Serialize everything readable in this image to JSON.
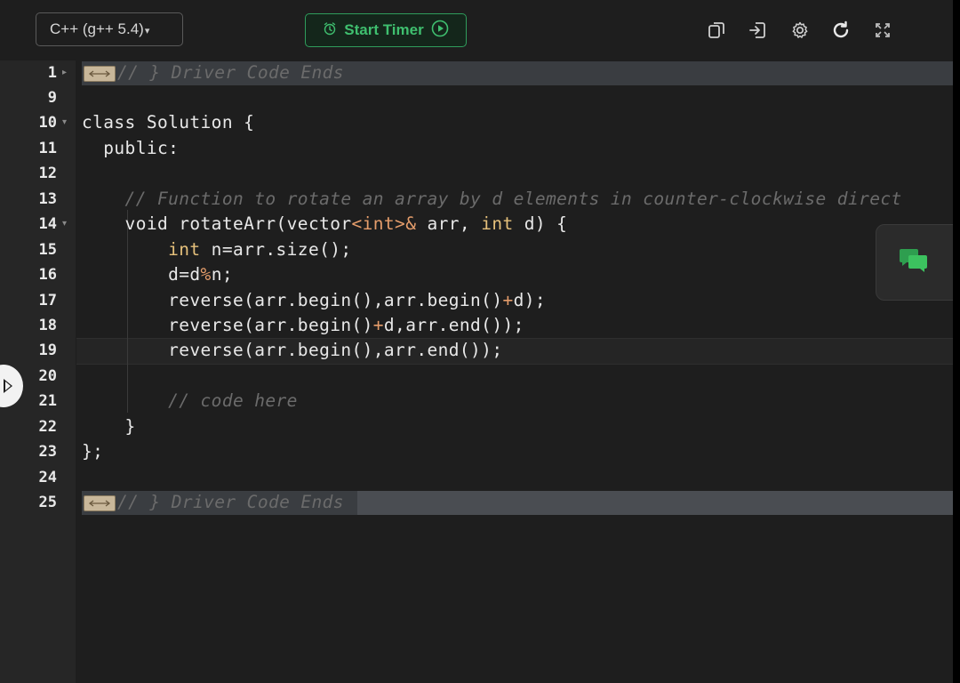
{
  "toolbar": {
    "language": "C++ (g++ 5.4)",
    "start_timer_label": "Start Timer",
    "icons": [
      "copy-icon",
      "sign-in-icon",
      "gear-icon",
      "refresh-icon",
      "fullscreen-icon"
    ]
  },
  "colors": {
    "accent_green": "#2f9d5c",
    "editor_bg": "#1e1e1e",
    "gutter_bg": "#262626"
  },
  "editor": {
    "lines": [
      {
        "no": "1",
        "text": "// } Driver Code Ends",
        "folded": true
      },
      {
        "no": "9",
        "text": ""
      },
      {
        "no": "10",
        "text": "class Solution {"
      },
      {
        "no": "11",
        "text": "  public:"
      },
      {
        "no": "12",
        "text": ""
      },
      {
        "no": "13",
        "text": "    // Function to rotate an array by d elements in counter-clockwise direct"
      },
      {
        "no": "14",
        "text_a": "    void rotateArr(vector",
        "text_b": "<int>&",
        "text_c": " arr, ",
        "text_d": "int",
        "text_e": " d) {"
      },
      {
        "no": "15",
        "text_a": "        ",
        "text_b": "int",
        "text_c": " n=arr.size();"
      },
      {
        "no": "16",
        "text_a": "        d=d",
        "text_b": "%",
        "text_c": "n;"
      },
      {
        "no": "17",
        "text_a": "        reverse(arr.begin(),arr.begin()",
        "text_b": "+",
        "text_c": "d);"
      },
      {
        "no": "18",
        "text_a": "        reverse(arr.begin()",
        "text_b": "+",
        "text_c": "d,arr.end());"
      },
      {
        "no": "19",
        "text": "        reverse(arr.begin(),arr.end());"
      },
      {
        "no": "20",
        "text": ""
      },
      {
        "no": "21",
        "text": "        // code here"
      },
      {
        "no": "22",
        "text": "    }"
      },
      {
        "no": "23",
        "text": "};"
      },
      {
        "no": "24",
        "text": ""
      },
      {
        "no": "25",
        "text": "// } Driver Code Ends",
        "folded": true
      }
    ]
  }
}
